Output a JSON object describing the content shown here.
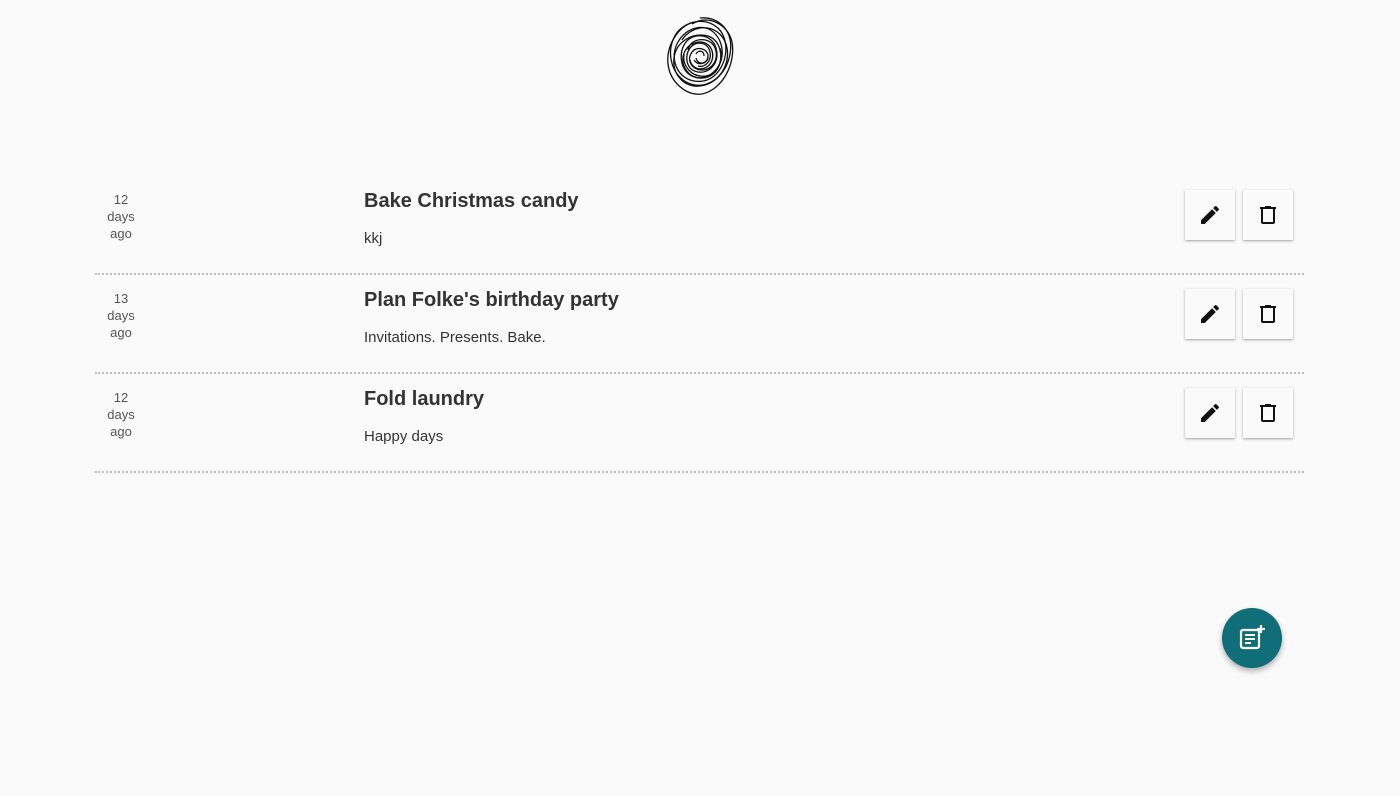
{
  "notes": [
    {
      "age_number": "12",
      "age_unit": "days",
      "age_suffix": "ago",
      "title": "Bake Christmas candy",
      "body": "kkj"
    },
    {
      "age_number": "13",
      "age_unit": "days",
      "age_suffix": "ago",
      "title": "Plan Folke's birthday party",
      "body": "Invitations. Presents. Bake."
    },
    {
      "age_number": "12",
      "age_unit": "days",
      "age_suffix": "ago",
      "title": "Fold laundry",
      "body": "Happy days"
    }
  ],
  "icons": {
    "logo": "scribble-logo",
    "edit": "pencil-icon",
    "delete": "trash-icon",
    "add_note": "note-add-icon"
  },
  "colors": {
    "background": "#fafafa",
    "fab": "#0f6e78",
    "divider": "#bdbdbd"
  }
}
